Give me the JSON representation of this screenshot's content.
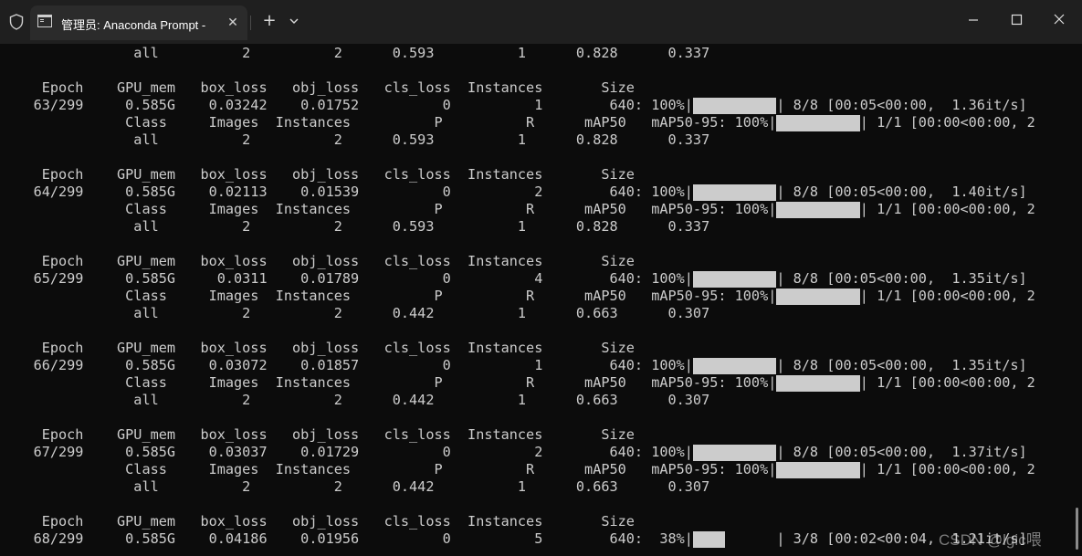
{
  "window": {
    "tab_title": "管理员: Anaconda Prompt - py",
    "tab_close_glyph": "✕",
    "new_tab_glyph": "+",
    "icons": [
      "shield-icon",
      "terminal-icon",
      "close-icon",
      "plus-icon",
      "chevron-down-icon",
      "minimize-icon",
      "maximize-icon",
      "close-window-icon"
    ],
    "background_color": "#0c0c0c",
    "titlebar_color": "#1f1f1f",
    "text_color": "#cccccc"
  },
  "terminal": {
    "lines": [
      "                all          2          2      0.593          1      0.828      0.337",
      "",
      "     Epoch    GPU_mem   box_loss   obj_loss   cls_loss  Instances       Size",
      "    63/299     0.585G    0.03242    0.01752          0          1        640: 100%|",
      "               Class     Images  Instances          P          R      mAP50   mAP50-95: 100%|",
      "                all          2          2      0.593          1      0.828      0.337",
      "",
      "     Epoch    GPU_mem   box_loss   obj_loss   cls_loss  Instances       Size",
      "    64/299     0.585G    0.02113    0.01539          0          2        640: 100%|",
      "               Class     Images  Instances          P          R      mAP50   mAP50-95: 100%|",
      "                all          2          2      0.593          1      0.828      0.337",
      "",
      "     Epoch    GPU_mem   box_loss   obj_loss   cls_loss  Instances       Size",
      "    65/299     0.585G     0.0311    0.01789          0          4        640: 100%|",
      "               Class     Images  Instances          P          R      mAP50   mAP50-95: 100%|",
      "                all          2          2      0.442          1      0.663      0.307",
      "",
      "     Epoch    GPU_mem   box_loss   obj_loss   cls_loss  Instances       Size",
      "    66/299     0.585G    0.03072    0.01857          0          1        640: 100%|",
      "               Class     Images  Instances          P          R      mAP50   mAP50-95: 100%|",
      "                all          2          2      0.442          1      0.663      0.307",
      "",
      "     Epoch    GPU_mem   box_loss   obj_loss   cls_loss  Instances       Size",
      "    67/299     0.585G    0.03037    0.01729          0          2        640: 100%|",
      "               Class     Images  Instances          P          R      mAP50   mAP50-95: 100%|",
      "                all          2          2      0.442          1      0.663      0.307",
      "",
      "     Epoch    GPU_mem   box_loss   obj_loss   cls_loss  Instances       Size",
      "    68/299     0.585G    0.04186    0.01956          0          5        640:  38%|"
    ],
    "progress_bars": [
      {
        "line": 3,
        "progress": 1.0,
        "tail": "| 8/8 [00:05<00:00,  1.36it/s]"
      },
      {
        "line": 4,
        "progress": 1.0,
        "tail": "| 1/1 [00:00<00:00, 2"
      },
      {
        "line": 8,
        "progress": 1.0,
        "tail": "| 8/8 [00:05<00:00,  1.40it/s]"
      },
      {
        "line": 9,
        "progress": 1.0,
        "tail": "| 1/1 [00:00<00:00, 2"
      },
      {
        "line": 13,
        "progress": 1.0,
        "tail": "| 8/8 [00:05<00:00,  1.35it/s]"
      },
      {
        "line": 14,
        "progress": 1.0,
        "tail": "| 1/1 [00:00<00:00, 2"
      },
      {
        "line": 18,
        "progress": 1.0,
        "tail": "| 8/8 [00:05<00:00,  1.35it/s]"
      },
      {
        "line": 19,
        "progress": 1.0,
        "tail": "| 1/1 [00:00<00:00, 2"
      },
      {
        "line": 23,
        "progress": 1.0,
        "tail": "| 8/8 [00:05<00:00,  1.37it/s]"
      },
      {
        "line": 24,
        "progress": 1.0,
        "tail": "| 1/1 [00:00<00:00, 2"
      },
      {
        "line": 28,
        "progress": 0.38,
        "tail": "| 3/8 [00:02<00:04,  1.21it/s]"
      }
    ]
  },
  "watermark": "CSDN @lgic喂"
}
